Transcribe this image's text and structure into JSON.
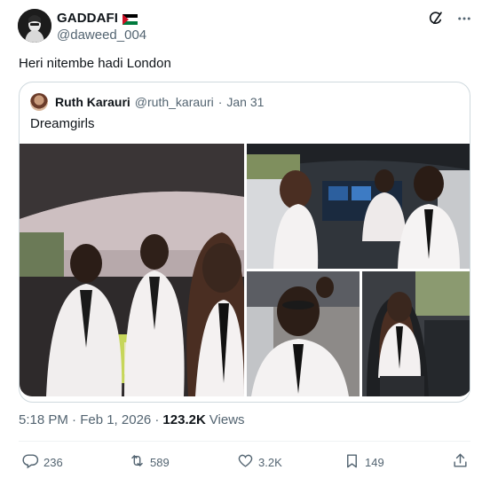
{
  "tweet": {
    "author": {
      "display_name": "GADDAFI",
      "handle": "@daweed_004",
      "flag_icon": "palestine-flag-icon"
    },
    "text": "Heri nitembe hadi London",
    "quoted": {
      "author": {
        "display_name": "Ruth Karauri",
        "handle": "@ruth_karauri",
        "date": "Jan 31"
      },
      "separator": "·",
      "text": "Dreamgirls",
      "media_count": 4
    },
    "meta": {
      "time": "5:18 PM · Feb 1, 2026 ·",
      "views_count": "123.2K",
      "views_label": "Views"
    },
    "actions": {
      "replies": "236",
      "reposts": "589",
      "likes": "3.2K",
      "bookmarks": "149"
    }
  },
  "colors": {
    "text": "#0f1419",
    "secondary": "#536471",
    "border": "#cfd9de",
    "flag_green": "#007a3d",
    "flag_red": "#ce1126"
  }
}
